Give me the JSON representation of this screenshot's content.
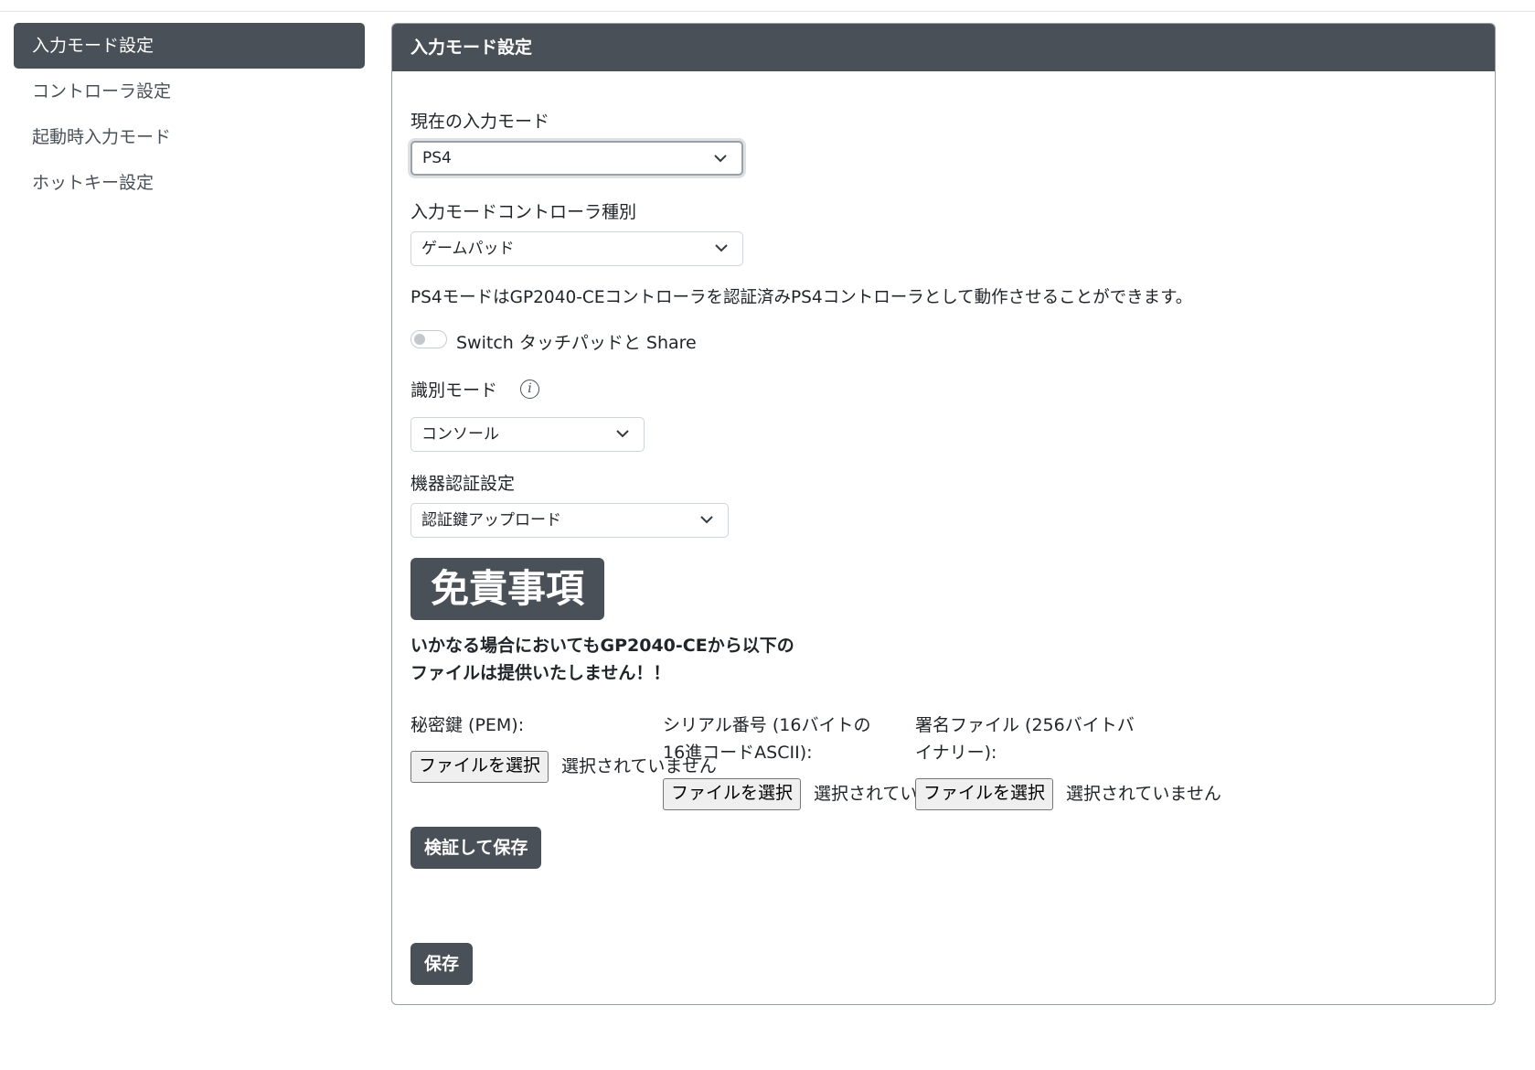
{
  "sidebar": {
    "items": [
      {
        "label": "入力モード設定",
        "active": true
      },
      {
        "label": "コントローラ設定",
        "active": false
      },
      {
        "label": "起動時入力モード",
        "active": false
      },
      {
        "label": "ホットキー設定",
        "active": false
      }
    ]
  },
  "card": {
    "title": "入力モード設定",
    "current_mode": {
      "label": "現在の入力モード",
      "value": "PS4"
    },
    "controller_type": {
      "label": "入力モードコントローラ種別",
      "value": "ゲームパッド"
    },
    "description": "PS4モードはGP2040-CEコントローラを認証済みPS4コントローラとして動作させることができます。",
    "toggle": {
      "label": "Switch タッチパッドと Share",
      "on": false
    },
    "id_mode": {
      "label": "識別モード",
      "info_icon": "info-icon",
      "value": "コンソール"
    },
    "auth": {
      "label": "機器認証設定",
      "value": "認証鍵アップロード"
    },
    "disclaimer": {
      "badge": "免責事項",
      "line1": "いかなる場合においてもGP2040-CEから以下の",
      "line2": "ファイルは提供いたしません！！"
    },
    "files": [
      {
        "label_line1": "秘密鍵 (PEM):",
        "label_line2": "",
        "button": "ファイルを選択",
        "status": "選択されていません"
      },
      {
        "label_line1": "シリアル番号 (16バイトの",
        "label_line2": "16進コードASCII):",
        "button": "ファイルを選択",
        "status": "選択されてい"
      },
      {
        "label_line1": "署名ファイル (256バイトバ",
        "label_line2": "イナリー):",
        "button": "ファイルを選択",
        "status": "選択されていません"
      }
    ],
    "verify_button": "検証して保存",
    "save_button": "保存"
  },
  "colors": {
    "accent": "#495057",
    "border": "#ced4da"
  }
}
